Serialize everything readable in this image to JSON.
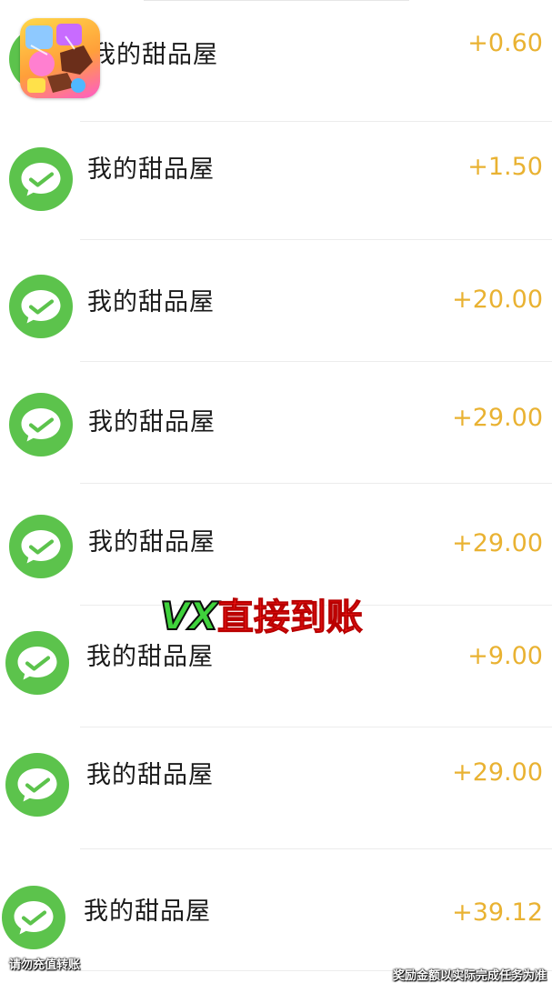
{
  "list": {
    "items": [
      {
        "name": "我的甜品屋",
        "amount": "+0.60",
        "icon": "wechat-pay-icon"
      },
      {
        "name": "我的甜品屋",
        "amount": "+1.50",
        "icon": "wechat-pay-icon"
      },
      {
        "name": "我的甜品屋",
        "amount": "+20.00",
        "icon": "wechat-pay-icon"
      },
      {
        "name": "我的甜品屋",
        "amount": "+29.00",
        "icon": "wechat-pay-icon"
      },
      {
        "name": "我的甜品屋",
        "amount": "+29.00",
        "icon": "wechat-pay-icon"
      },
      {
        "name": "我的甜品屋",
        "amount": "+9.00",
        "icon": "wechat-pay-icon"
      },
      {
        "name": "我的甜品屋",
        "amount": "+29.00",
        "icon": "wechat-pay-icon"
      },
      {
        "name": "我的甜品屋",
        "amount": "+39.12",
        "icon": "wechat-pay-icon"
      }
    ]
  },
  "overlay": {
    "app_icon": "dessert-game-app-icon",
    "promo_prefix": "VX",
    "promo_suffix": "直接到账",
    "caption_left": "请勿充值转账",
    "caption_right": "奖励金额以实际完成任务为准"
  },
  "colors": {
    "amount": "#e9b232",
    "wechat_green": "#5cc34c",
    "promo_green": "#3fd23c",
    "promo_red": "#ff1a1a"
  }
}
